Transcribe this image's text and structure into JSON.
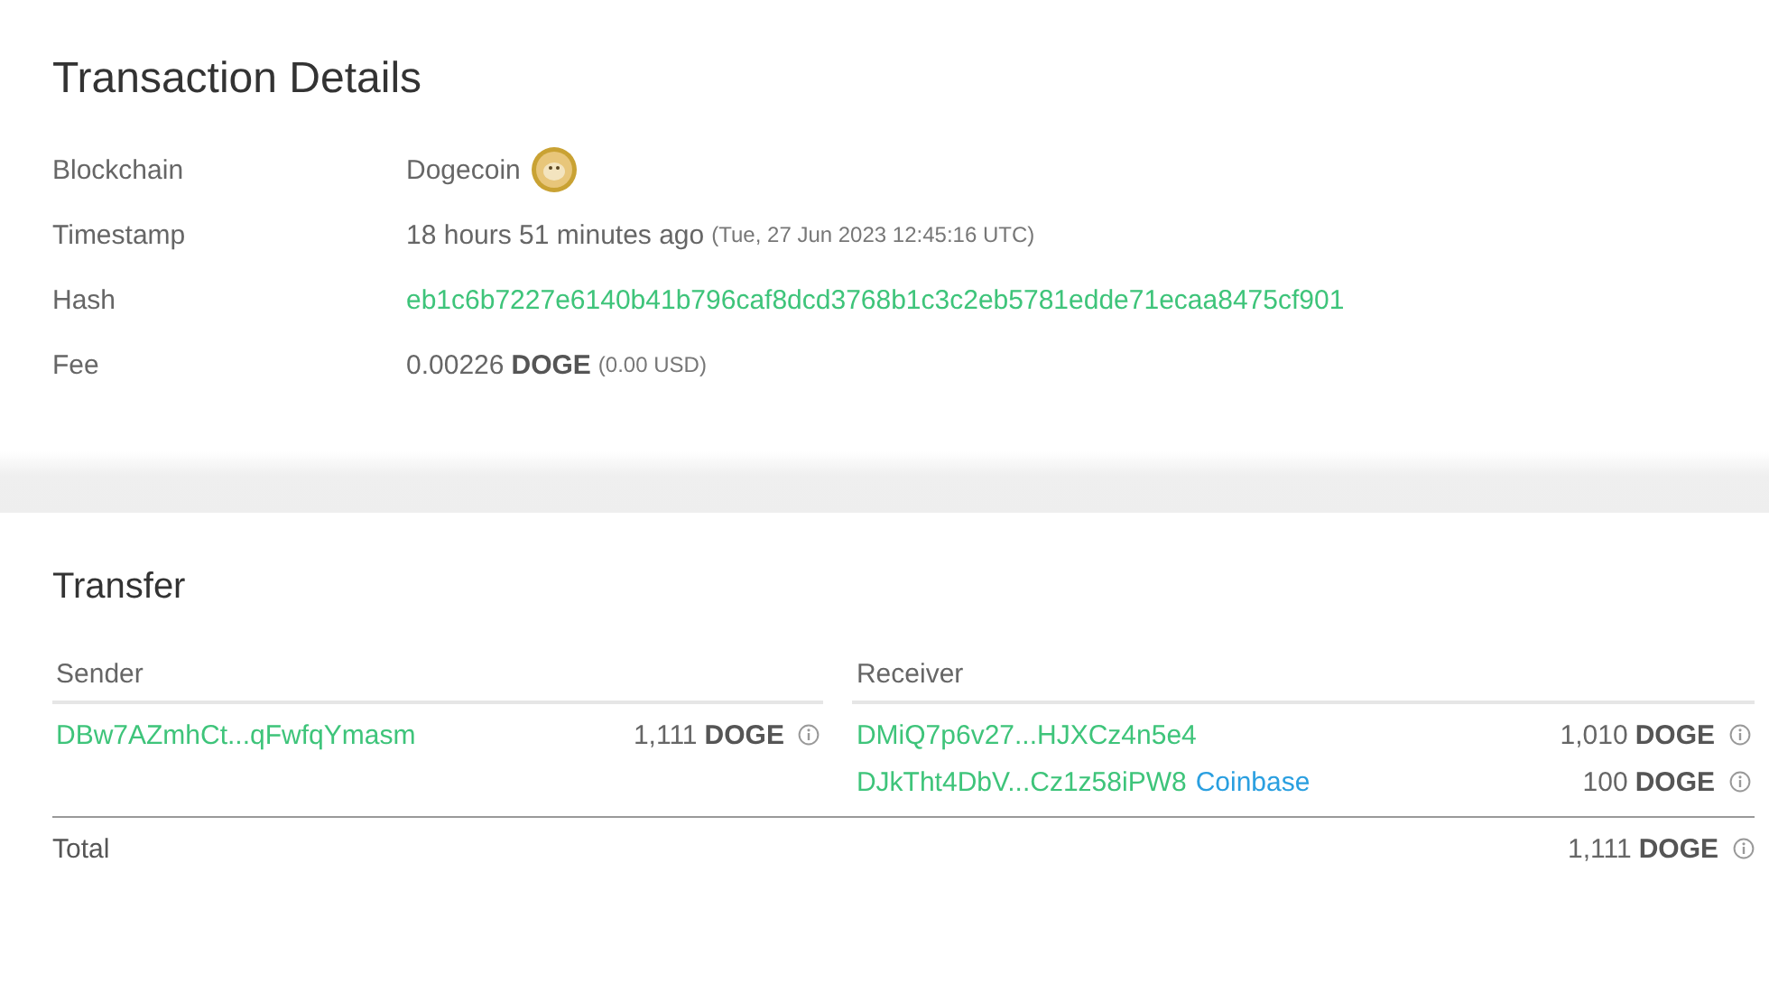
{
  "details": {
    "title": "Transaction Details",
    "rows": [
      {
        "kind": "coin",
        "label": "Blockchain",
        "value": "Dogecoin"
      },
      {
        "kind": "time",
        "label": "Timestamp",
        "value": "18 hours 51 minutes ago",
        "note": "(Tue, 27 Jun 2023 12:45:16 UTC)"
      },
      {
        "kind": "hash",
        "label": "Hash",
        "value": "eb1c6b7227e6140b41b796caf8dcd3768b1c3c2eb5781edde71ecaa8475cf901"
      },
      {
        "kind": "fee",
        "label": "Fee",
        "value": "0.00226",
        "unit": "DOGE",
        "note": "(0.00 USD)"
      }
    ]
  },
  "transfer": {
    "title": "Transfer",
    "sender_heading": "Sender",
    "receiver_heading": "Receiver",
    "senders": [
      {
        "address": "DBw7AZmhCt...qFwfqYmasm",
        "amount": "1,111",
        "unit": "DOGE"
      }
    ],
    "receivers": [
      {
        "address": "DMiQ7p6v27...HJXCz4n5e4",
        "amount": "1,010",
        "unit": "DOGE"
      },
      {
        "address": "DJkTht4DbV...Cz1z58iPW8",
        "tag": "Coinbase",
        "amount": "100",
        "unit": "DOGE"
      }
    ],
    "total": {
      "label": "Total",
      "amount": "1,111",
      "unit": "DOGE"
    }
  }
}
